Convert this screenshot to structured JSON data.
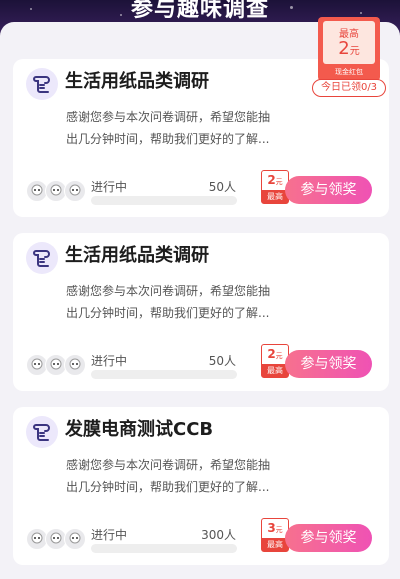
{
  "header": {
    "title": "参与趣味调查"
  },
  "daily_reward": {
    "top_label": "最高",
    "amount": "2",
    "unit": "元",
    "kind": "现金红包",
    "limit_text": "今日已领0/3"
  },
  "colors": {
    "accent": "#e8453c",
    "button_start": "#f7718e",
    "button_end": "#ef52b4",
    "icon_bg": "#ece8fb",
    "icon": "#3b3580"
  },
  "surveys": [
    {
      "title": "生活用纸品类调研",
      "desc": "感谢您参与本次问卷调研，希望您能抽出几分钟时间，帮助我们更好的了解...",
      "status": "进行中",
      "participants": "50人",
      "reward_amount": "2",
      "reward_unit": "元",
      "reward_label": "最高",
      "button": "参与领奖",
      "icon": "scroll-icon"
    },
    {
      "title": "生活用纸品类调研",
      "desc": "感谢您参与本次问卷调研，希望您能抽出几分钟时间，帮助我们更好的了解...",
      "status": "进行中",
      "participants": "50人",
      "reward_amount": "2",
      "reward_unit": "元",
      "reward_label": "最高",
      "button": "参与领奖",
      "icon": "scroll-icon"
    },
    {
      "title": "发膜电商测试CCB",
      "desc": "感谢您参与本次问卷调研，希望您能抽出几分钟时间，帮助我们更好的了解...",
      "status": "进行中",
      "participants": "300人",
      "reward_amount": "3",
      "reward_unit": "元",
      "reward_label": "最高",
      "button": "参与领奖",
      "icon": "scroll-icon"
    }
  ]
}
